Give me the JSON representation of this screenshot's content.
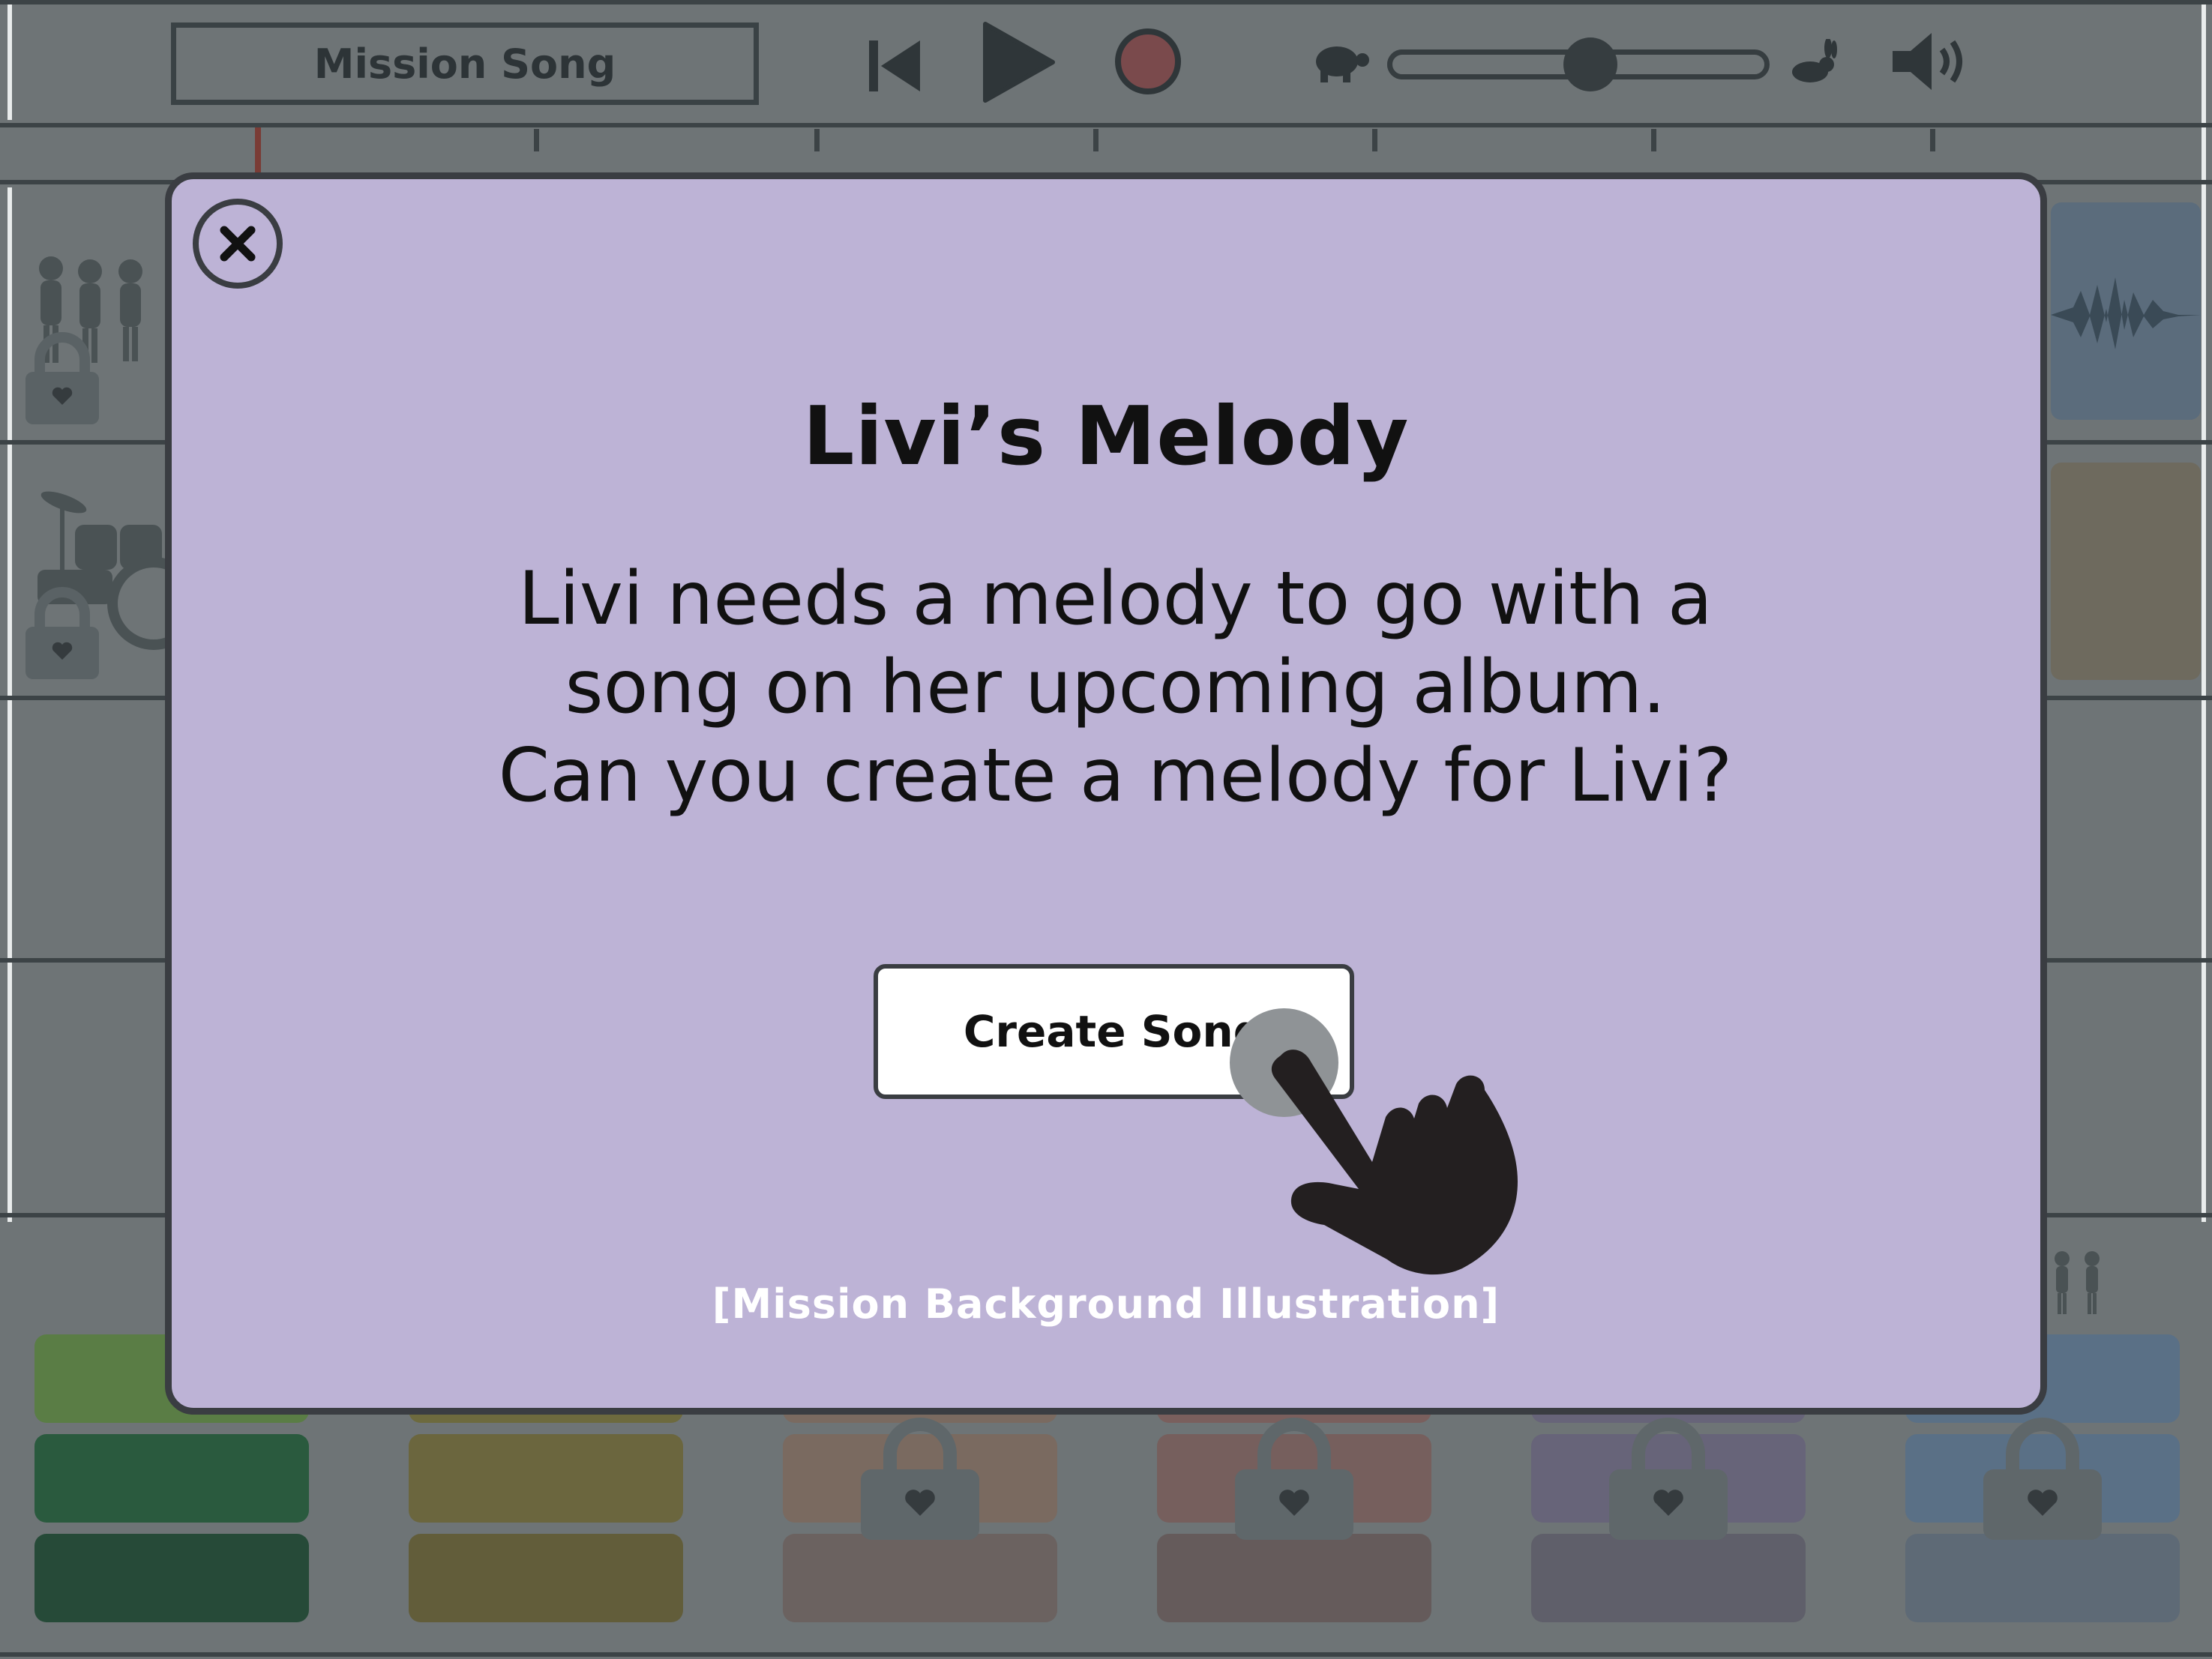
{
  "toolbar": {
    "song_title": "Mission Song",
    "skip_back_icon": "skip-back-icon",
    "play_icon": "play-icon",
    "record_icon": "record-icon",
    "slow_icon": "turtle-icon",
    "fast_icon": "rabbit-icon",
    "volume_icon": "speaker-icon",
    "tempo_level": 0.52
  },
  "tracks": [
    {
      "name": "vocals",
      "locked": true,
      "icon": "singers-icon"
    },
    {
      "name": "drums",
      "locked": true,
      "icon": "drum-kit-icon"
    },
    {
      "name": "track-3",
      "locked": false
    },
    {
      "name": "track-4",
      "locked": false
    }
  ],
  "pad_palette": {
    "columns": [
      {
        "color_top": "#5a7d45",
        "color_mid": "#2a5a3e",
        "color_bot": "#264a38",
        "locked": false
      },
      {
        "color_top": "#6d6a3e",
        "color_mid": "#6b663e",
        "color_bot": "#625d3a",
        "locked": false
      },
      {
        "color_top": "#7a6a60",
        "color_mid": "#7a6a60",
        "color_bot": "#6b6260",
        "locked": true
      },
      {
        "color_top": "#7a5f5d",
        "color_mid": "#765f5d",
        "color_bot": "#655b5b",
        "locked": true
      },
      {
        "color_top": "#676479",
        "color_mid": "#676479",
        "color_bot": "#5f5f6a",
        "locked": true
      },
      {
        "color_top": "#5a7086",
        "color_mid": "#5a7086",
        "color_bot": "#5e6a76",
        "locked": true
      }
    ]
  },
  "modal": {
    "close_icon": "close-icon",
    "title": "Livi’s Melody",
    "body_lines": [
      "Livi needs a melody to go with a",
      "song on her upcoming album.",
      "Can you create a melody for Livi?"
    ],
    "cta_label": "Create Song",
    "background_label": "[Mission Background Illustration]",
    "pointer_icon": "pointing-hand-icon",
    "colors": {
      "panel": "#bdb3d6",
      "border": "#3a3d42"
    }
  }
}
